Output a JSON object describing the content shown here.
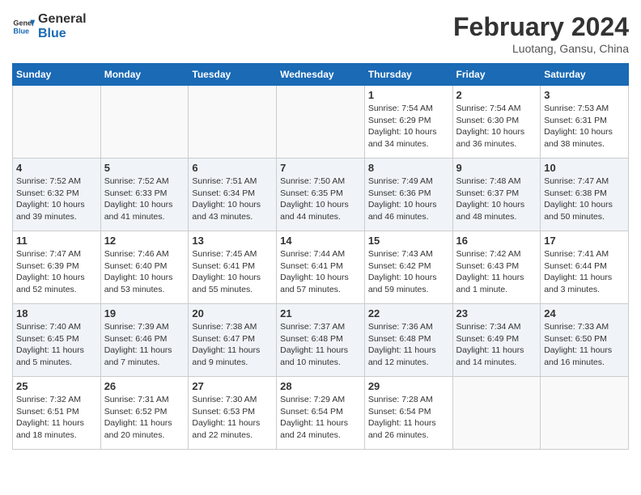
{
  "header": {
    "logo_line1": "General",
    "logo_line2": "Blue",
    "month": "February 2024",
    "location": "Luotang, Gansu, China"
  },
  "days_of_week": [
    "Sunday",
    "Monday",
    "Tuesday",
    "Wednesday",
    "Thursday",
    "Friday",
    "Saturday"
  ],
  "weeks": [
    [
      {
        "day": "",
        "info": ""
      },
      {
        "day": "",
        "info": ""
      },
      {
        "day": "",
        "info": ""
      },
      {
        "day": "",
        "info": ""
      },
      {
        "day": "1",
        "info": "Sunrise: 7:54 AM\nSunset: 6:29 PM\nDaylight: 10 hours\nand 34 minutes."
      },
      {
        "day": "2",
        "info": "Sunrise: 7:54 AM\nSunset: 6:30 PM\nDaylight: 10 hours\nand 36 minutes."
      },
      {
        "day": "3",
        "info": "Sunrise: 7:53 AM\nSunset: 6:31 PM\nDaylight: 10 hours\nand 38 minutes."
      }
    ],
    [
      {
        "day": "4",
        "info": "Sunrise: 7:52 AM\nSunset: 6:32 PM\nDaylight: 10 hours\nand 39 minutes."
      },
      {
        "day": "5",
        "info": "Sunrise: 7:52 AM\nSunset: 6:33 PM\nDaylight: 10 hours\nand 41 minutes."
      },
      {
        "day": "6",
        "info": "Sunrise: 7:51 AM\nSunset: 6:34 PM\nDaylight: 10 hours\nand 43 minutes."
      },
      {
        "day": "7",
        "info": "Sunrise: 7:50 AM\nSunset: 6:35 PM\nDaylight: 10 hours\nand 44 minutes."
      },
      {
        "day": "8",
        "info": "Sunrise: 7:49 AM\nSunset: 6:36 PM\nDaylight: 10 hours\nand 46 minutes."
      },
      {
        "day": "9",
        "info": "Sunrise: 7:48 AM\nSunset: 6:37 PM\nDaylight: 10 hours\nand 48 minutes."
      },
      {
        "day": "10",
        "info": "Sunrise: 7:47 AM\nSunset: 6:38 PM\nDaylight: 10 hours\nand 50 minutes."
      }
    ],
    [
      {
        "day": "11",
        "info": "Sunrise: 7:47 AM\nSunset: 6:39 PM\nDaylight: 10 hours\nand 52 minutes."
      },
      {
        "day": "12",
        "info": "Sunrise: 7:46 AM\nSunset: 6:40 PM\nDaylight: 10 hours\nand 53 minutes."
      },
      {
        "day": "13",
        "info": "Sunrise: 7:45 AM\nSunset: 6:41 PM\nDaylight: 10 hours\nand 55 minutes."
      },
      {
        "day": "14",
        "info": "Sunrise: 7:44 AM\nSunset: 6:41 PM\nDaylight: 10 hours\nand 57 minutes."
      },
      {
        "day": "15",
        "info": "Sunrise: 7:43 AM\nSunset: 6:42 PM\nDaylight: 10 hours\nand 59 minutes."
      },
      {
        "day": "16",
        "info": "Sunrise: 7:42 AM\nSunset: 6:43 PM\nDaylight: 11 hours\nand 1 minute."
      },
      {
        "day": "17",
        "info": "Sunrise: 7:41 AM\nSunset: 6:44 PM\nDaylight: 11 hours\nand 3 minutes."
      }
    ],
    [
      {
        "day": "18",
        "info": "Sunrise: 7:40 AM\nSunset: 6:45 PM\nDaylight: 11 hours\nand 5 minutes."
      },
      {
        "day": "19",
        "info": "Sunrise: 7:39 AM\nSunset: 6:46 PM\nDaylight: 11 hours\nand 7 minutes."
      },
      {
        "day": "20",
        "info": "Sunrise: 7:38 AM\nSunset: 6:47 PM\nDaylight: 11 hours\nand 9 minutes."
      },
      {
        "day": "21",
        "info": "Sunrise: 7:37 AM\nSunset: 6:48 PM\nDaylight: 11 hours\nand 10 minutes."
      },
      {
        "day": "22",
        "info": "Sunrise: 7:36 AM\nSunset: 6:48 PM\nDaylight: 11 hours\nand 12 minutes."
      },
      {
        "day": "23",
        "info": "Sunrise: 7:34 AM\nSunset: 6:49 PM\nDaylight: 11 hours\nand 14 minutes."
      },
      {
        "day": "24",
        "info": "Sunrise: 7:33 AM\nSunset: 6:50 PM\nDaylight: 11 hours\nand 16 minutes."
      }
    ],
    [
      {
        "day": "25",
        "info": "Sunrise: 7:32 AM\nSunset: 6:51 PM\nDaylight: 11 hours\nand 18 minutes."
      },
      {
        "day": "26",
        "info": "Sunrise: 7:31 AM\nSunset: 6:52 PM\nDaylight: 11 hours\nand 20 minutes."
      },
      {
        "day": "27",
        "info": "Sunrise: 7:30 AM\nSunset: 6:53 PM\nDaylight: 11 hours\nand 22 minutes."
      },
      {
        "day": "28",
        "info": "Sunrise: 7:29 AM\nSunset: 6:54 PM\nDaylight: 11 hours\nand 24 minutes."
      },
      {
        "day": "29",
        "info": "Sunrise: 7:28 AM\nSunset: 6:54 PM\nDaylight: 11 hours\nand 26 minutes."
      },
      {
        "day": "",
        "info": ""
      },
      {
        "day": "",
        "info": ""
      }
    ]
  ]
}
